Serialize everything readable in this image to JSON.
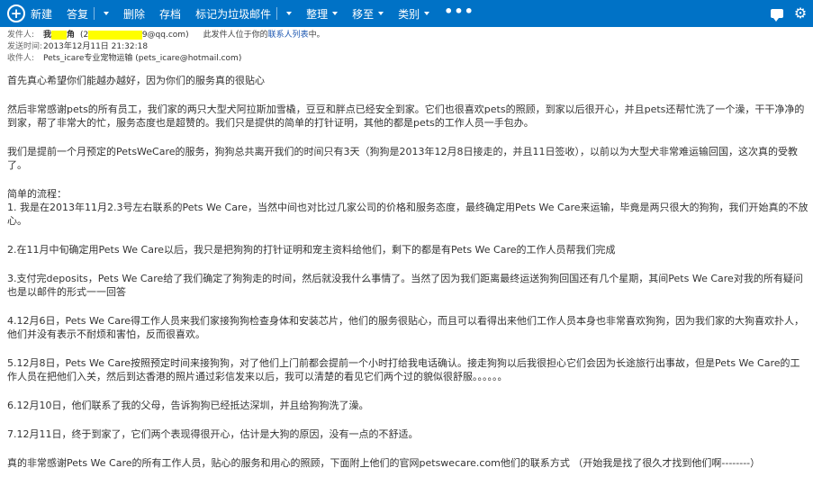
{
  "toolbar": {
    "new_label": "新建",
    "reply_label": "答复",
    "delete_label": "删除",
    "archive_label": "存档",
    "junk_label": "标记为垃圾邮件",
    "organize_label": "整理",
    "move_label": "移至",
    "category_label": "类别",
    "more_label": "•••"
  },
  "header": {
    "from_label": "发件人:",
    "from_name_a": "我",
    "from_name_hidden": "■■",
    "from_name_b": "角",
    "from_email_a": "(2",
    "from_email_hidden": "■■■■■■■",
    "from_email_b": "9@qq.com)",
    "contact_note_a": "此发件人位于你的",
    "contact_note_link": "联系人列表",
    "contact_note_b": "中。",
    "sent_label": "发送时间:",
    "sent_value": "2013年12月11日 21:32:18",
    "to_label": "收件人:",
    "to_value": "Pets_icare专业宠物运输 (pets_icare@hotmail.com)"
  },
  "body": {
    "p1": "首先真心希望你们能越办越好，因为你们的服务真的很贴心",
    "p2": "然后非常感谢pets的所有员工，我们家的两只大型犬阿拉斯加雪橇，豆豆和胖点已经安全到家。它们也很喜欢pets的照顾，到家以后很开心，并且pets还帮忙洗了一个澡，干干净净的到家，帮了非常大的忙，服务态度也是超赞的。我们只是提供的简单的打针证明，其他的都是pets的工作人员一手包办。",
    "p3": "我们是提前一个月预定的PetsWeCare的服务，狗狗总共离开我们的时间只有3天（狗狗是2013年12月8日接走的，并且11日签收），以前以为大型犬非常难运输回国，这次真的受教了。",
    "p4a": "简单的流程：",
    "p4b": "1. 我是在2013年11月2.3号左右联系的Pets  We Care，当然中间也对比过几家公司的价格和服务态度，最终确定用Pets  We Care来运输，毕竟是两只很大的狗狗，我们开始真的不放心。",
    "p5": "2.在11月中旬确定用Pets  We Care以后，我只是把狗狗的打针证明和宠主资料给他们，剩下的都是有Pets  We Care的工作人员帮我们完成",
    "p6": "3.支付完deposits，Pets  We Care给了我们确定了狗狗走的时间，然后就没我什么事情了。当然了因为我们距离最终运送狗狗回国还有几个星期，其间Pets  We Care对我的所有疑问也是以邮件的形式一一回答",
    "p7": "4.12月6日，Pets  We Care得工作人员来我们家接狗狗检查身体和安装芯片，他们的服务很贴心，而且可以看得出来他们工作人员本身也非常喜欢狗狗，因为我们家的大狗喜欢扑人，他们并没有表示不耐烦和害怕，反而很喜欢。",
    "p8": "5.12月8日，Pets  We Care按照预定时间来接狗狗，对了他们上门前都会提前一个小时打给我电话确认。接走狗狗以后我很担心它们会因为长途旅行出事故，但是Pets  We Care的工作人员在把他们入关，然后到达香港的照片通过彩信发来以后，我可以清楚的看见它们两个过的貌似很舒服。。。。。。",
    "p9": "6.12月10日，他们联系了我的父母，告诉狗狗已经抵达深圳，并且给狗狗洗了澡。",
    "p10": "7.12月11日，终于到家了，它们两个表现得很开心，估计是大狗的原因，没有一点的不舒适。",
    "p11": "真的非常感谢Pets  We Care的所有工作人员，贴心的服务和用心的照顾，下面附上他们的官网petswecare.com他们的联系方式  （开始我是找了很久才找到他们啊--------）"
  }
}
